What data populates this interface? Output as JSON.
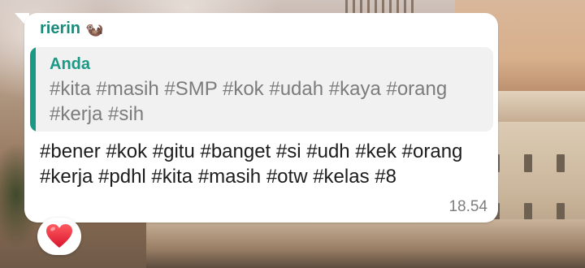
{
  "message": {
    "sender": "rierin",
    "sender_emoji": "🦦",
    "quoted": {
      "author": "Anda",
      "text": "#kita #masih #SMP #kok #udah #kaya #orang #kerja #sih"
    },
    "text": "#bener #kok #gitu #banget #si #udh #kek #orang #kerja #pdhl #kita #masih #otw #kelas #8",
    "time": "18.54",
    "reaction": "❤️"
  },
  "colors": {
    "sender": "#1a8a7a",
    "quote_accent": "#1a9a86",
    "reaction_heart": "#e3203a"
  },
  "icons": {
    "reaction": "heart-icon"
  }
}
